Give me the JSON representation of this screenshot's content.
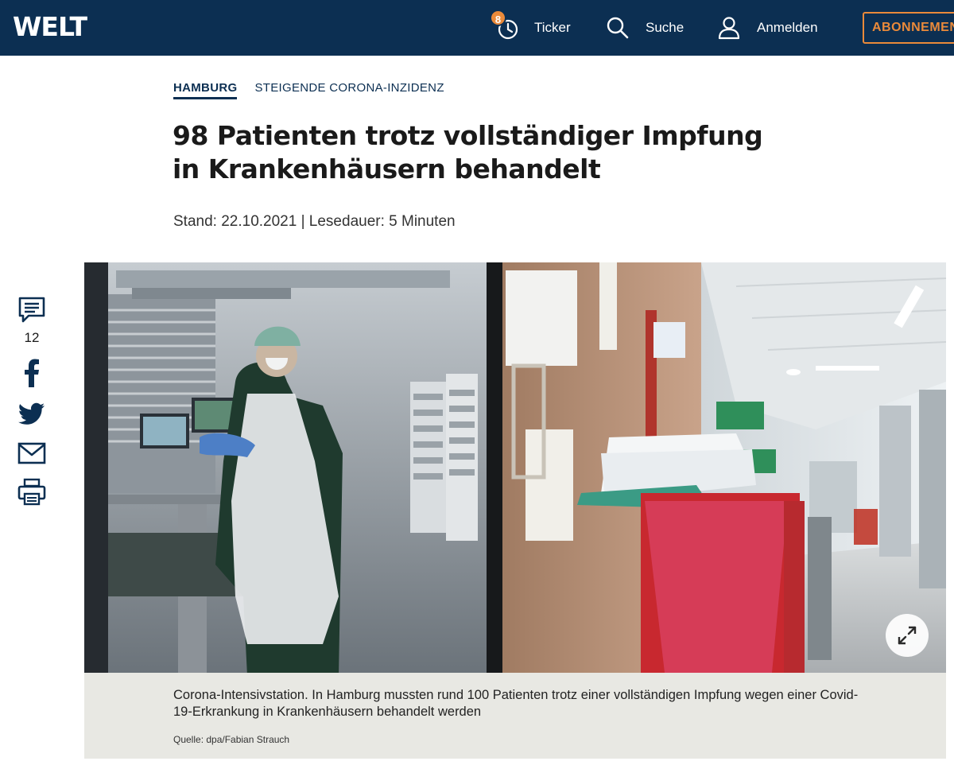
{
  "header": {
    "logo": "WELT",
    "ticker_badge": "8",
    "ticker_label": "Ticker",
    "search_label": "Suche",
    "login_label": "Anmelden",
    "subscribe_label": "ABONNEMENT",
    "colors": {
      "background": "#0c2f52",
      "accent": "#ea8a3a"
    }
  },
  "article": {
    "section": "HAMBURG",
    "topic": "STEIGENDE CORONA-INZIDENZ",
    "headline": "98 Patienten trotz vollständiger Impfung in Krankenhäusern behandelt",
    "meta": "Stand: 22.10.2021 | Lesedauer: 5 Minuten"
  },
  "share": {
    "comment_count": "12",
    "icons": [
      "comment-icon",
      "facebook-icon",
      "twitter-icon",
      "mail-icon",
      "print-icon"
    ]
  },
  "image": {
    "caption": "Corona-Intensivstation. In Hamburg mussten rund 100 Patienten trotz einer vollständigen Impfung wegen einer Covid-19-Erkrankung in Krankenhäusern behandelt werden",
    "source": "Quelle: dpa/Fabian Strauch",
    "expand_icon": "expand-icon"
  }
}
